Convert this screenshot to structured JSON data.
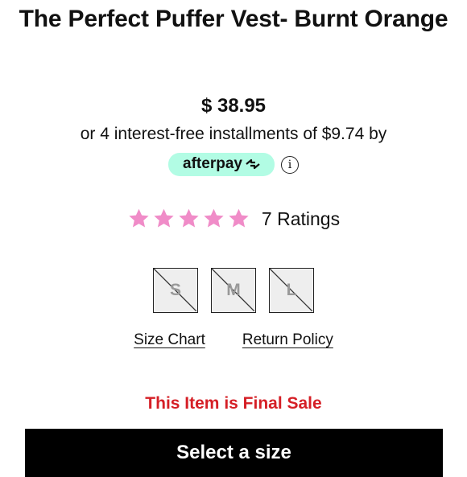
{
  "product": {
    "title": "The Perfect Puffer Vest- Burnt Orange",
    "price": "$ 38.95",
    "installments_text": "or 4 interest-free installments of $9.74 by",
    "afterpay_label": "afterpay",
    "afterpay_color": "#b2fce4"
  },
  "rating": {
    "stars": 5,
    "star_color": "#f08cc8",
    "count_text": "7 Ratings"
  },
  "sizes": [
    {
      "label": "S",
      "available": false
    },
    {
      "label": "M",
      "available": false
    },
    {
      "label": "L",
      "available": false
    }
  ],
  "links": {
    "size_chart": "Size Chart",
    "return_policy": "Return Policy"
  },
  "final_sale_text": "This Item is Final Sale",
  "final_sale_color": "#d51f26",
  "cta_label": "Select a size",
  "icons": [
    "afterpay-arrows-icon",
    "info-icon",
    "star-icon"
  ]
}
